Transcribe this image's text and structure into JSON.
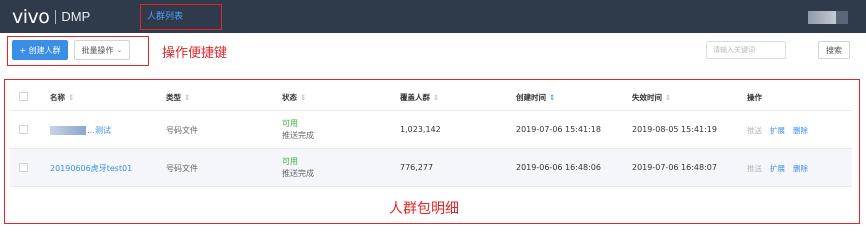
{
  "header": {
    "logo_brand": "vivo",
    "logo_product": "DMP",
    "nav_active": "人群列表"
  },
  "toolbar": {
    "create_label": "+ 创建人群",
    "batch_label": "批量操作",
    "batch_chevron": "chevron-down-icon",
    "search_placeholder": "请输入关键词",
    "search_label": "搜索"
  },
  "annotations": {
    "toolbar_note": "操作便捷键",
    "table_note": "人群包明细"
  },
  "table": {
    "columns": [
      "名称",
      "类型",
      "状态",
      "覆盖人群",
      "创建时间",
      "失效时间",
      "操作"
    ],
    "rows": [
      {
        "name": "…测试",
        "type": "号码文件",
        "status": "可用",
        "substatus": "推送完成",
        "coverage": "1,023,142",
        "created": "2019-07-06 15:41:18",
        "expires": "2019-08-05 15:41:19",
        "actions": [
          "推送",
          "扩展",
          "删除"
        ]
      },
      {
        "name": "20190606虎牙test01",
        "type": "号码文件",
        "status": "可用",
        "substatus": "推送完成",
        "coverage": "776,277",
        "created": "2019-06-06 16:48:06",
        "expires": "2019-07-06 16:48:07",
        "actions": [
          "推送",
          "扩展",
          "删除"
        ]
      }
    ]
  },
  "colors": {
    "topbar": "#2f3a4b",
    "primary": "#3a8ee6",
    "annotation": "#e3262a",
    "status_ok": "#41b14a"
  }
}
